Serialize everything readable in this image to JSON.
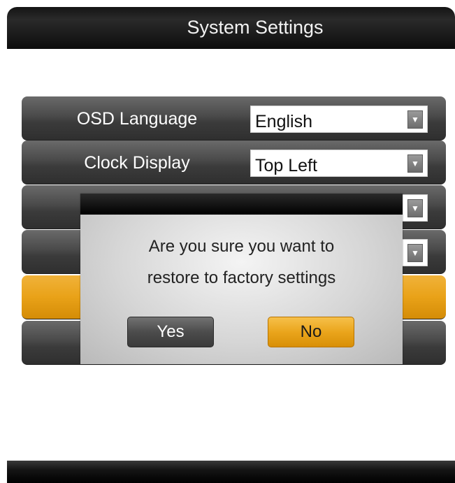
{
  "header": {
    "title": "System Settings"
  },
  "rows": [
    {
      "label": "OSD Language",
      "value": "English"
    },
    {
      "label": "Clock Display",
      "value": "Top Left"
    },
    {
      "label": "",
      "value": ""
    },
    {
      "label": "",
      "value": ""
    },
    {
      "label": ""
    },
    {
      "label": ""
    }
  ],
  "dialog": {
    "line1": "Are you sure you want to",
    "line2": "restore to factory settings",
    "yes_label": "Yes",
    "no_label": "No"
  },
  "icons": {
    "dropdown": "chevron-down-icon"
  },
  "colors": {
    "accent": "#e9a218",
    "bar": "#1a1a1a",
    "row": "#4a4a4a"
  }
}
